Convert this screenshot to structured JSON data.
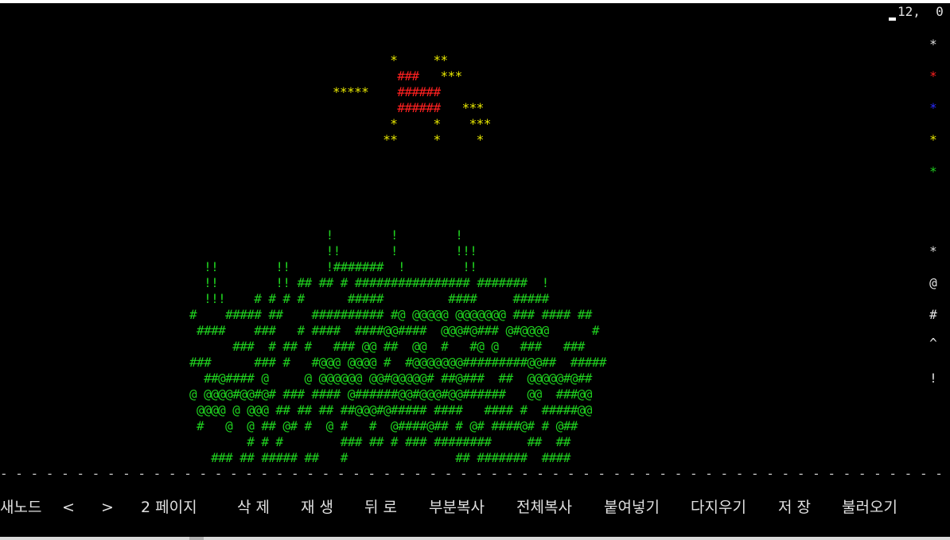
{
  "status": {
    "coords": "12,  0"
  },
  "palette": [
    {
      "char": "*",
      "color": "#e0e0e0",
      "name": "palette-white-star-icon"
    },
    {
      "char": "*",
      "color": "#ff2020",
      "name": "palette-red-star-icon"
    },
    {
      "char": "*",
      "color": "#2a2aff",
      "name": "palette-blue-star-icon"
    },
    {
      "char": "*",
      "color": "#e8e800",
      "name": "palette-yellow-star-icon"
    },
    {
      "char": "*",
      "color": "#1fd11f",
      "name": "palette-green-star-icon"
    },
    {
      "char": "*",
      "color": "#e0e0e0",
      "name": "palette-star-char-icon"
    },
    {
      "char": "@",
      "color": "#e0e0e0",
      "name": "palette-at-char-icon"
    },
    {
      "char": "#",
      "color": "#e0e0e0",
      "name": "palette-hash-char-icon"
    },
    {
      "char": "^",
      "color": "#e0e0e0",
      "name": "palette-caret-char-icon"
    },
    {
      "char": "!",
      "color": "#e0e0e0",
      "name": "palette-bang-char-icon"
    }
  ],
  "fireworks": [
    [
      {
        "t": "        *     **",
        "c": "#e8e800"
      }
    ],
    [
      {
        "t": "         ",
        "c": "#e8e800"
      },
      {
        "t": "###",
        "c": "#ff2020"
      },
      {
        "t": "   ***",
        "c": "#e8e800"
      }
    ],
    [
      {
        "t": "*****    ",
        "c": "#e8e800"
      },
      {
        "t": "######",
        "c": "#ff2020"
      }
    ],
    [
      {
        "t": "         ",
        "c": "#e8e800"
      },
      {
        "t": "######",
        "c": "#ff2020"
      },
      {
        "t": "   ***",
        "c": "#e8e800"
      }
    ],
    [
      {
        "t": "        *     *    ***",
        "c": "#e8e800"
      }
    ],
    [
      {
        "t": "       **     *     *",
        "c": "#e8e800"
      }
    ]
  ],
  "city_lines": [
    "                   !        !        !",
    "                   !!       !        !!!",
    "  !!        !!     !#######  !        !!",
    "  !!        !! ## ## # ################ #######  !",
    "  !!!    # # # #      #####         ####     #####",
    "#    ##### ##    ########## #@ @@@@@ @@@@@@@ ### #### ##",
    " ####    ###   # ####  ####@@####  @@@#@### @#@@@@      #",
    "      ###  # ## #   ### @@ ##  @@  #   #@ @   ###   ###",
    "###      ### #   #@@@ @@@@ #  #@@@@@@@#########@@##  #####",
    "  ##@#### @     @ @@@@@@ @@#@@@@@# ##@###  ##  @@@@@#@##",
    "@ @@@@#@@#@# ### #### @######@@#@@@#@@######   @@  ###@@",
    " @@@@ @ @@@ ## ## ## ##@@@#@##### ####   #### #  #####@@",
    " #   @  @ ## @# #  @ #   #  @####@## # @# ####@# # @##",
    "        # # #        ### ## # ### ########     ##  ##",
    "   ### ## ##### ##   #               ## #######  ####"
  ],
  "separator": "- - - - - - - - - - - - - - - - - - - - - - - - - - - - - - - - - - - - - - - - - - - - - - - - - - - - - - - - - - - - - - - - - - - - - - - - - -",
  "menu": [
    {
      "label": "새노드",
      "name": "new-node-button"
    },
    {
      "label": "<",
      "name": "prev-page-button"
    },
    {
      "label": ">",
      "name": "next-page-button"
    },
    {
      "label": "2 페이지",
      "name": "page-indicator"
    },
    {
      "label": "삭 제",
      "name": "delete-button"
    },
    {
      "label": "재 생",
      "name": "play-button"
    },
    {
      "label": "뒤 로",
      "name": "back-button"
    },
    {
      "label": "부분복사",
      "name": "partial-copy-button"
    },
    {
      "label": "전체복사",
      "name": "full-copy-button"
    },
    {
      "label": "붙여넣기",
      "name": "paste-button"
    },
    {
      "label": "다지우기",
      "name": "clear-all-button"
    },
    {
      "label": "저 장",
      "name": "save-button"
    },
    {
      "label": "불러오기",
      "name": "load-button"
    }
  ]
}
